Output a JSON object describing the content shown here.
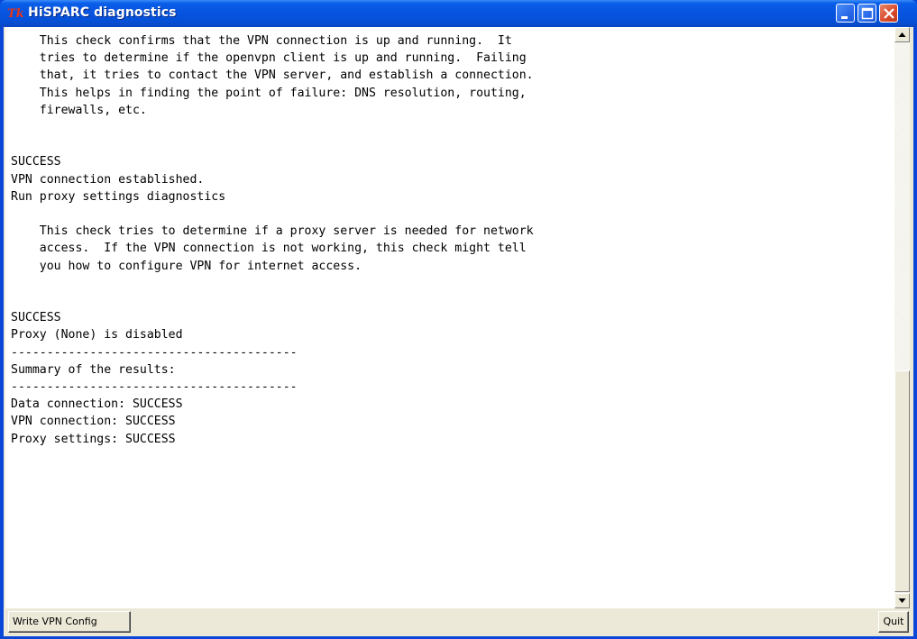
{
  "window": {
    "title": "HiSPARC diagnostics",
    "icon": "tk-feather-icon",
    "controls": [
      "minimize-icon",
      "maximize-icon",
      "close-icon"
    ]
  },
  "output_text": "    This check confirms that the VPN connection is up and running.  It\n    tries to determine if the openvpn client is up and running.  Failing\n    that, it tries to contact the VPN server, and establish a connection.\n    This helps in finding the point of failure: DNS resolution, routing,\n    firewalls, etc.\n\n\nSUCCESS\nVPN connection established.\nRun proxy settings diagnostics\n\n    This check tries to determine if a proxy server is needed for network\n    access.  If the VPN connection is not working, this check might tell\n    you how to configure VPN for internet access.\n\n\nSUCCESS\nProxy (None) is disabled\n----------------------------------------\nSummary of the results:\n----------------------------------------\nData connection: SUCCESS\nVPN connection: SUCCESS\nProxy settings: SUCCESS",
  "buttons": {
    "write_vpn_config": "Write VPN Config",
    "quit": "Quit"
  },
  "colors": {
    "titlebar": "#0754e0",
    "close_button": "#d84a2a",
    "client_background": "#ece9d8"
  }
}
